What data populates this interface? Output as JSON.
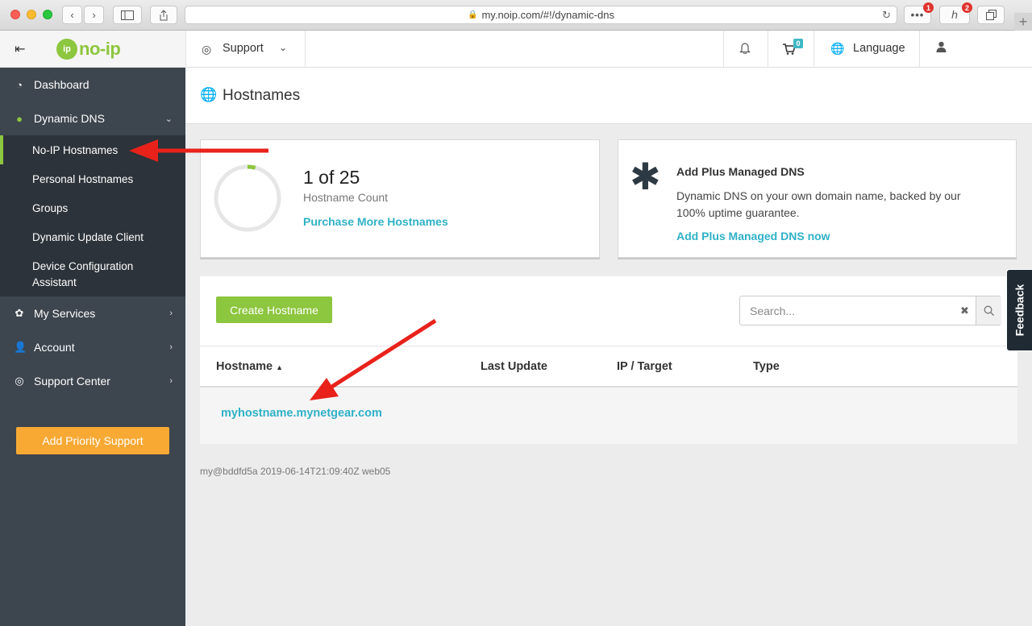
{
  "browser": {
    "url": "my.noip.com/#!/dynamic-dns",
    "badge_more": "1",
    "badge_ext": "2"
  },
  "logo": {
    "mark": "ip",
    "text": "no-ip"
  },
  "sidebar": {
    "items": [
      {
        "label": "Dashboard"
      },
      {
        "label": "Dynamic DNS"
      },
      {
        "label": "My Services"
      },
      {
        "label": "Account"
      },
      {
        "label": "Support Center"
      }
    ],
    "subitems": [
      {
        "label": "No-IP Hostnames"
      },
      {
        "label": "Personal Hostnames"
      },
      {
        "label": "Groups"
      },
      {
        "label": "Dynamic Update Client"
      },
      {
        "label": "Device Configuration Assistant"
      }
    ],
    "priority_label": "Add Priority Support"
  },
  "topnav": {
    "support": "Support",
    "cart_count": "0",
    "language": "Language"
  },
  "page": {
    "title": "Hostnames",
    "count_text": "1 of 25",
    "count_label": "Hostname Count",
    "count_progress": 0.04,
    "purchase_link": "Purchase More Hostnames",
    "plus_title": "Add Plus Managed DNS",
    "plus_desc": "Dynamic DNS on your own domain name, backed by our 100% uptime guarantee.",
    "plus_link": "Add Plus Managed DNS now",
    "create_label": "Create Hostname",
    "search_placeholder": "Search...",
    "columns": [
      "Hostname",
      "Last Update",
      "IP / Target",
      "Type"
    ],
    "rows": [
      {
        "hostname": "myhostname.mynetgear.com"
      }
    ],
    "footer": "my@bddfd5a 2019-06-14T21:09:40Z web05",
    "feedback": "Feedback"
  },
  "colors": {
    "brand_green": "#8dc63f",
    "link_teal": "#2fb1c7",
    "sidebar_bg": "#3d454e",
    "priority_orange": "#f7a934",
    "annotation_red": "#e8221b"
  }
}
